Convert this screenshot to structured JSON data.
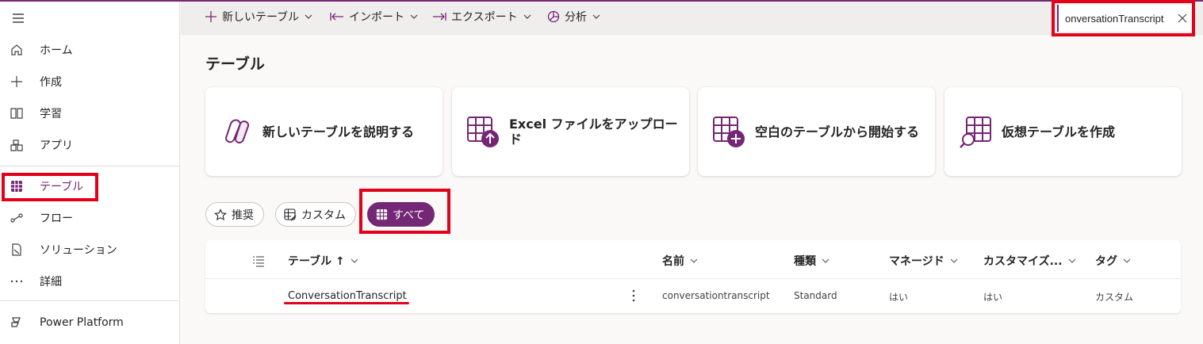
{
  "sidebar": {
    "items": [
      {
        "label": "ホーム",
        "icon": "home-icon"
      },
      {
        "label": "作成",
        "icon": "plus-icon"
      },
      {
        "label": "学習",
        "icon": "book-icon"
      },
      {
        "label": "アプリ",
        "icon": "apps-icon"
      },
      {
        "label": "テーブル",
        "icon": "table-grid-icon"
      },
      {
        "label": "フロー",
        "icon": "flow-icon"
      },
      {
        "label": "ソリューション",
        "icon": "solution-icon"
      },
      {
        "label": "詳細",
        "icon": "more-icon"
      }
    ],
    "footer": {
      "label": "Power Platform",
      "icon": "power-platform-icon"
    }
  },
  "commandbar": {
    "new_table": "新しいテーブル",
    "import": "インポート",
    "export": "エクスポート",
    "analyze": "分析"
  },
  "search": {
    "value": "onversationTranscript"
  },
  "page": {
    "title": "テーブル"
  },
  "cards": [
    {
      "label": "新しいテーブルを説明する",
      "icon": "copilot-icon"
    },
    {
      "label": "Excel ファイルをアップロード",
      "icon": "upload-table-icon"
    },
    {
      "label": "空白のテーブルから開始する",
      "icon": "add-table-icon"
    },
    {
      "label": "仮想テーブルを作成",
      "icon": "search-table-icon"
    }
  ],
  "filters": [
    {
      "label": "推奨",
      "icon": "star-icon",
      "active": false
    },
    {
      "label": "カスタム",
      "icon": "custom-table-icon",
      "active": false
    },
    {
      "label": "すべて",
      "icon": "grid-icon",
      "active": true
    }
  ],
  "table": {
    "columns": [
      "テーブル ↑",
      "名前",
      "種類",
      "マネージド",
      "カスタマイズ...",
      "タグ"
    ],
    "rows": [
      {
        "display_name": "ConversationTranscript",
        "name": "conversationtranscript",
        "type": "Standard",
        "managed": "はい",
        "customizable": "はい",
        "tag": "カスタム"
      }
    ]
  },
  "colors": {
    "accent": "#742774",
    "highlight": "#e3001b"
  }
}
